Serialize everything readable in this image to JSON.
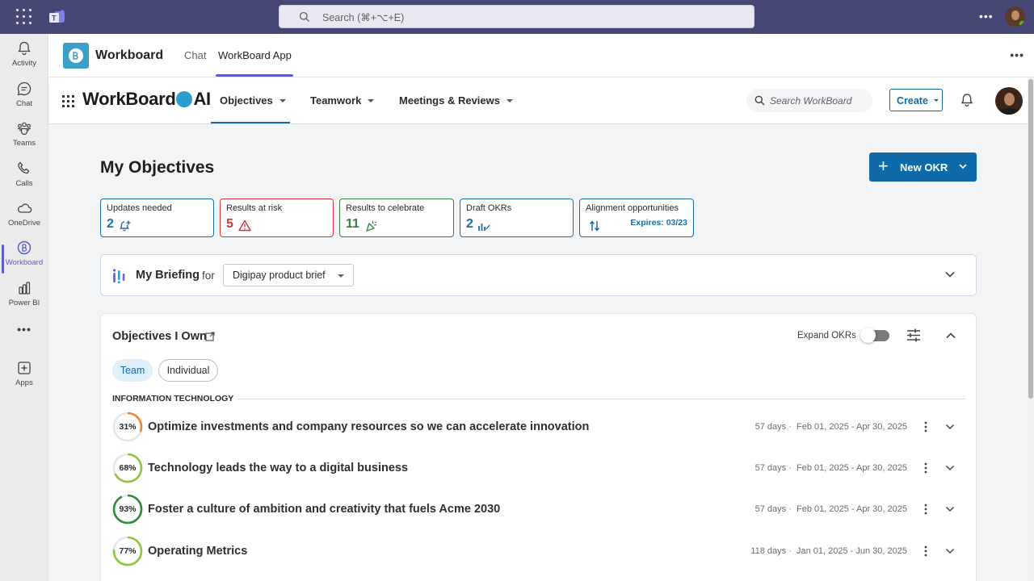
{
  "topbar": {
    "search_placeholder": "Search (⌘+⌥+E)",
    "more_icon": "more-horizontal-icon"
  },
  "rail": {
    "items": [
      {
        "label": "Activity",
        "icon": "bell-icon"
      },
      {
        "label": "Chat",
        "icon": "chat-icon"
      },
      {
        "label": "Teams",
        "icon": "teams-icon"
      },
      {
        "label": "Calls",
        "icon": "phone-icon"
      },
      {
        "label": "OneDrive",
        "icon": "cloud-icon"
      },
      {
        "label": "Workboard",
        "icon": "workboard-icon",
        "active": true
      },
      {
        "label": "Power BI",
        "icon": "powerbi-icon"
      },
      {
        "label": "...",
        "icon": "more-icon"
      },
      {
        "label": "Apps",
        "icon": "apps-icon"
      }
    ]
  },
  "app_header": {
    "title": "Workboard",
    "tabs": [
      "Chat",
      "WorkBoard App"
    ],
    "active_tab": "WorkBoard App"
  },
  "wb_nav": {
    "logo_text_1": "WorkBoard",
    "logo_text_2": "AI",
    "items": [
      "Objectives",
      "Teamwork",
      "Meetings & Reviews"
    ],
    "active_item": "Objectives",
    "search_placeholder": "Search WorkBoard",
    "create_label": "Create"
  },
  "page": {
    "title": "My Objectives",
    "new_okr_label": "New OKR"
  },
  "stats": [
    {
      "title": "Updates needed",
      "value": "2",
      "icon": "bell-plus-icon"
    },
    {
      "title": "Results at risk",
      "value": "5",
      "icon": "warning-icon"
    },
    {
      "title": "Results to celebrate",
      "value": "11",
      "icon": "party-popper-icon"
    },
    {
      "title": "Draft OKRs",
      "value": "2",
      "icon": "draft-chart-icon"
    },
    {
      "title": "Alignment opportunities",
      "value": "",
      "icon": "swap-arrows-icon",
      "expires": "Expires: 03/23"
    }
  ],
  "briefing": {
    "title": "My Briefing",
    "for_label": "for",
    "selected": "Digipay product brief"
  },
  "objectives": {
    "title": "Objectives I Own",
    "expand_label": "Expand OKRs",
    "expand_on": false,
    "filters": [
      "Team",
      "Individual"
    ],
    "active_filter": "Team",
    "section": "INFORMATION TECHNOLOGY",
    "rows": [
      {
        "percent": 31,
        "percent_label": "31%",
        "title": "Optimize investments and company resources so we can accelerate innovation",
        "duration": "57 days",
        "dates": "Feb 01, 2025 - Apr 30, 2025",
        "color": "#f0862b"
      },
      {
        "percent": 68,
        "percent_label": "68%",
        "title": "Technology leads the way to a digital business",
        "duration": "57 days",
        "dates": "Feb 01, 2025 - Apr 30, 2025",
        "color": "#8cc63f"
      },
      {
        "percent": 93,
        "percent_label": "93%",
        "title": "Foster a culture of ambition and creativity that fuels Acme 2030",
        "duration": "57 days",
        "dates": "Feb 01, 2025 - Apr 30, 2025",
        "color": "#2e8b3a"
      },
      {
        "percent": 77,
        "percent_label": "77%",
        "title": "Operating Metrics",
        "duration": "118 days",
        "dates": "Jan 01, 2025 - Jun 30, 2025",
        "color": "#8cc63f"
      }
    ]
  },
  "colors": {
    "teams_purple": "#464775",
    "accent": "#5b5fc7",
    "wb_blue": "#0e6aa8",
    "risk": "#d13438",
    "celebrate": "#2e8540"
  }
}
